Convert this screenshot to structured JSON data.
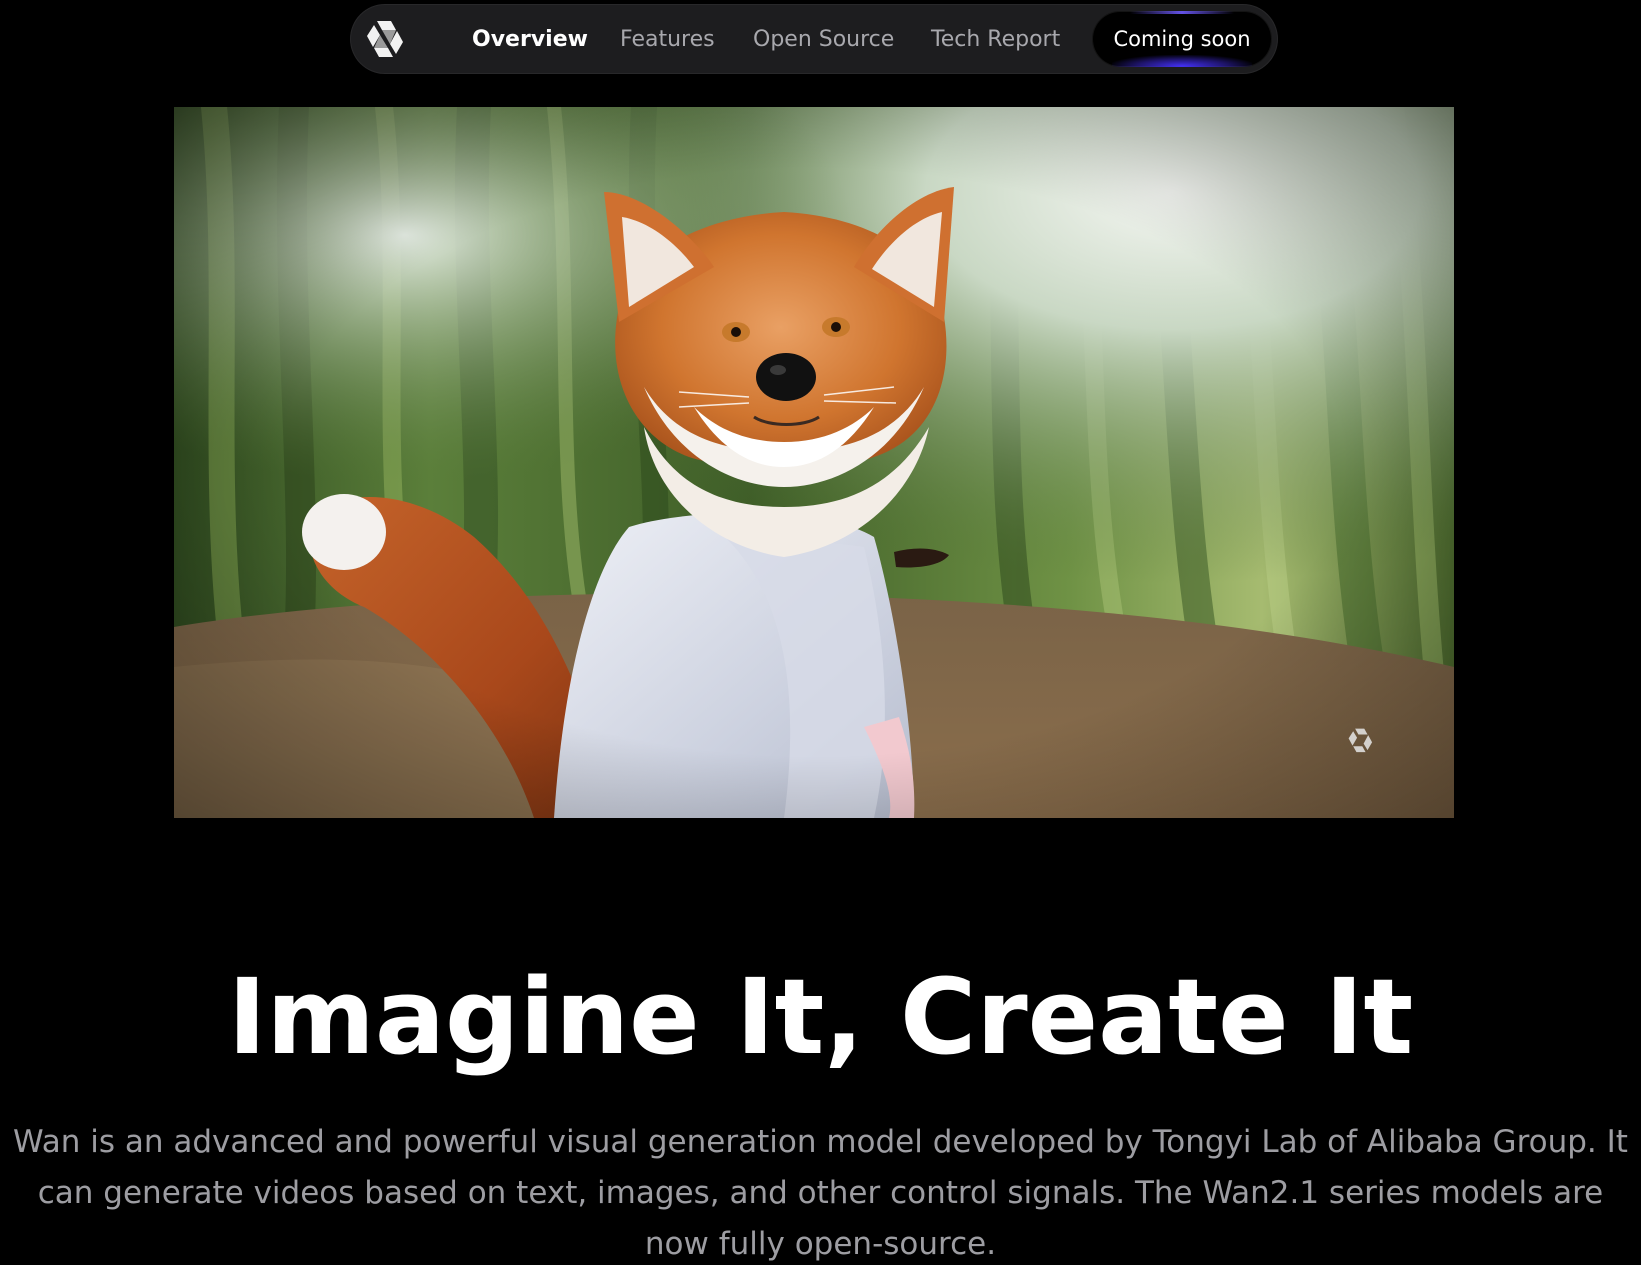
{
  "nav": {
    "logo_icon": "tongyi-logo-icon",
    "items": [
      {
        "label": "Overview",
        "active": true
      },
      {
        "label": "Features",
        "active": false
      },
      {
        "label": "Open Source",
        "active": false
      },
      {
        "label": "Tech Report",
        "active": false
      }
    ],
    "cta_label": "Coming soon"
  },
  "hero": {
    "media_description_icon": "video-watermark-icon"
  },
  "headline": "Imagine It, Create It",
  "description": "Wan is an advanced and powerful visual generation model developed by Tongyi Lab of Alibaba Group. It can generate videos based on text, images, and other control signals. The Wan2.1 series models are now fully open-source.",
  "colors": {
    "background": "#000000",
    "nav_bg": "#1d1d1f",
    "nav_text": "#a8a8ad",
    "accent_glow": "#4632ff",
    "description_text": "#9d9da2"
  }
}
